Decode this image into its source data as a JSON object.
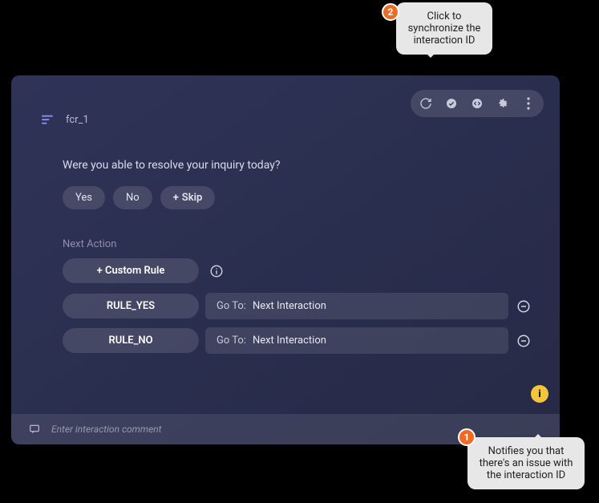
{
  "header": {
    "title": "fcr_1"
  },
  "toolbar": {
    "icons": [
      "refresh-icon",
      "check-circle-icon",
      "code-icon",
      "gear-icon",
      "more-icon"
    ]
  },
  "question": "Were you able to resolve your inquiry today?",
  "answers": {
    "yes": "Yes",
    "no": "No",
    "skip_prefix": "+",
    "skip": "Skip"
  },
  "next_action": {
    "label": "Next Action",
    "custom_rule_label": "+ Custom Rule",
    "rules": [
      {
        "name": "RULE_YES",
        "action_label": "Go To:",
        "action_value": "Next Interaction"
      },
      {
        "name": "RULE_NO",
        "action_label": "Go To:",
        "action_value": "Next Interaction"
      }
    ]
  },
  "warning_badge_glyph": "i",
  "comment": {
    "placeholder": "Enter interaction comment"
  },
  "annotations": {
    "n2": "2",
    "callout_top": "Click to synchronize the interaction ID",
    "n1": "1",
    "callout_bottom": "Notifies you that there's an issue with the interaction ID"
  }
}
